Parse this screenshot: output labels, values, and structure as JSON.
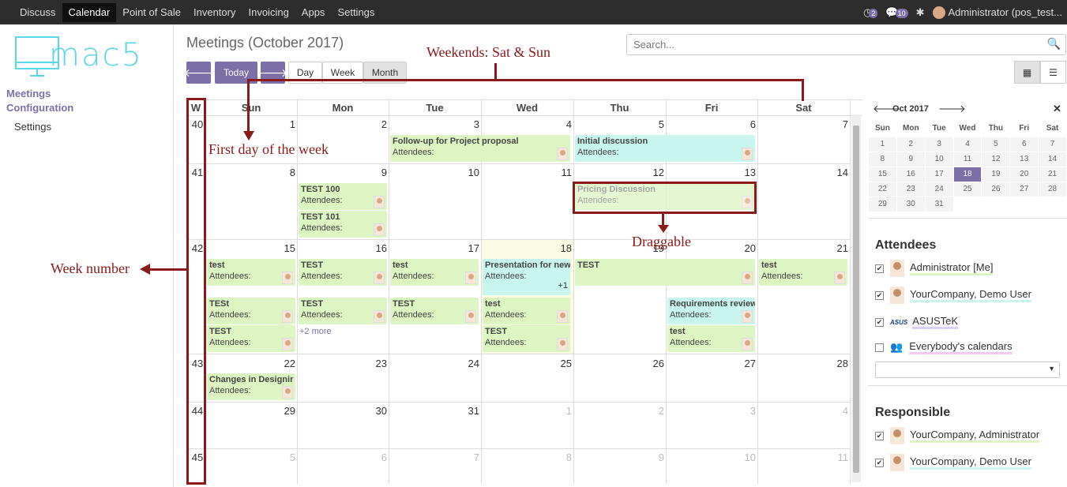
{
  "menu": {
    "items": [
      "Discuss",
      "Calendar",
      "Point of Sale",
      "Inventory",
      "Invoicing",
      "Apps",
      "Settings"
    ],
    "active": "Calendar",
    "msg_count": "2",
    "chat_count": "10",
    "user": "Administrator (pos_test..."
  },
  "sidebar": {
    "logo_text": "mac5",
    "heading1": "Meetings",
    "heading2": "Configuration",
    "item1": "Settings"
  },
  "page": {
    "title": "Meetings (October 2017)",
    "today": "Today",
    "day": "Day",
    "week": "Week",
    "month": "Month",
    "search_placeholder": "Search..."
  },
  "calendar": {
    "week_col": "W",
    "days": [
      "Sun",
      "Mon",
      "Tue",
      "Wed",
      "Thu",
      "Fri",
      "Sat"
    ],
    "weeks": [
      {
        "wk": "40",
        "dates": [
          "1",
          "2",
          "3",
          "4",
          "5",
          "6",
          "7"
        ]
      },
      {
        "wk": "41",
        "dates": [
          "8",
          "9",
          "10",
          "11",
          "12",
          "13",
          "14"
        ]
      },
      {
        "wk": "42",
        "dates": [
          "15",
          "16",
          "17",
          "18",
          "19",
          "20",
          "21"
        ]
      },
      {
        "wk": "43",
        "dates": [
          "22",
          "23",
          "24",
          "25",
          "26",
          "27",
          "28"
        ]
      },
      {
        "wk": "44",
        "dates": [
          "29",
          "30",
          "31",
          "1",
          "2",
          "3",
          "4"
        ]
      },
      {
        "wk": "45",
        "dates": [
          "5",
          "6",
          "7",
          "8",
          "9",
          "10",
          "11"
        ]
      }
    ],
    "attendees_label": "Attendees:",
    "more": "+2 more",
    "plus_one": "+1",
    "events": {
      "e1": "Follow-up for Project proposal",
      "e2": "Initial discussion",
      "e3": "TEST 100",
      "e4": "TEST 101",
      "e5": "Pricing Discussion",
      "e6": "test",
      "e7": "TEST",
      "e8": "test",
      "e9": "Presentation for new",
      "e10": "TEST",
      "e11": "test",
      "e12": "TESt",
      "e13": "TEST",
      "e14": "TEST",
      "e15": "test",
      "e16": "Requirements review",
      "e17": "TEST",
      "e18": "test",
      "e19": "TEST",
      "e20": "Changes in Designir"
    }
  },
  "mini": {
    "month": "Oct 2017",
    "days": [
      "Sun",
      "Mon",
      "Tue",
      "Wed",
      "Thu",
      "Fri",
      "Sat"
    ],
    "rows": [
      [
        "1",
        "2",
        "3",
        "4",
        "5",
        "6",
        "7"
      ],
      [
        "8",
        "9",
        "10",
        "11",
        "12",
        "13",
        "14"
      ],
      [
        "15",
        "16",
        "17",
        "18",
        "19",
        "20",
        "21"
      ],
      [
        "22",
        "23",
        "24",
        "25",
        "26",
        "27",
        "28"
      ],
      [
        "29",
        "30",
        "31",
        "",
        "",
        "",
        ""
      ]
    ],
    "selected": "18"
  },
  "filters": {
    "attendees_title": "Attendees",
    "a1": "Administrator [Me]",
    "a2": "YourCompany, Demo User",
    "a3": "ASUSTeK",
    "a4": "Everybody's calendars",
    "responsible_title": "Responsible",
    "r1": "YourCompany, Administrator",
    "r2": "YourCompany, Demo User"
  },
  "annotations": {
    "weekends": "Weekends: Sat & Sun",
    "first_day": "First day of the week",
    "draggable": "Draggable",
    "week_number": "Week number"
  }
}
